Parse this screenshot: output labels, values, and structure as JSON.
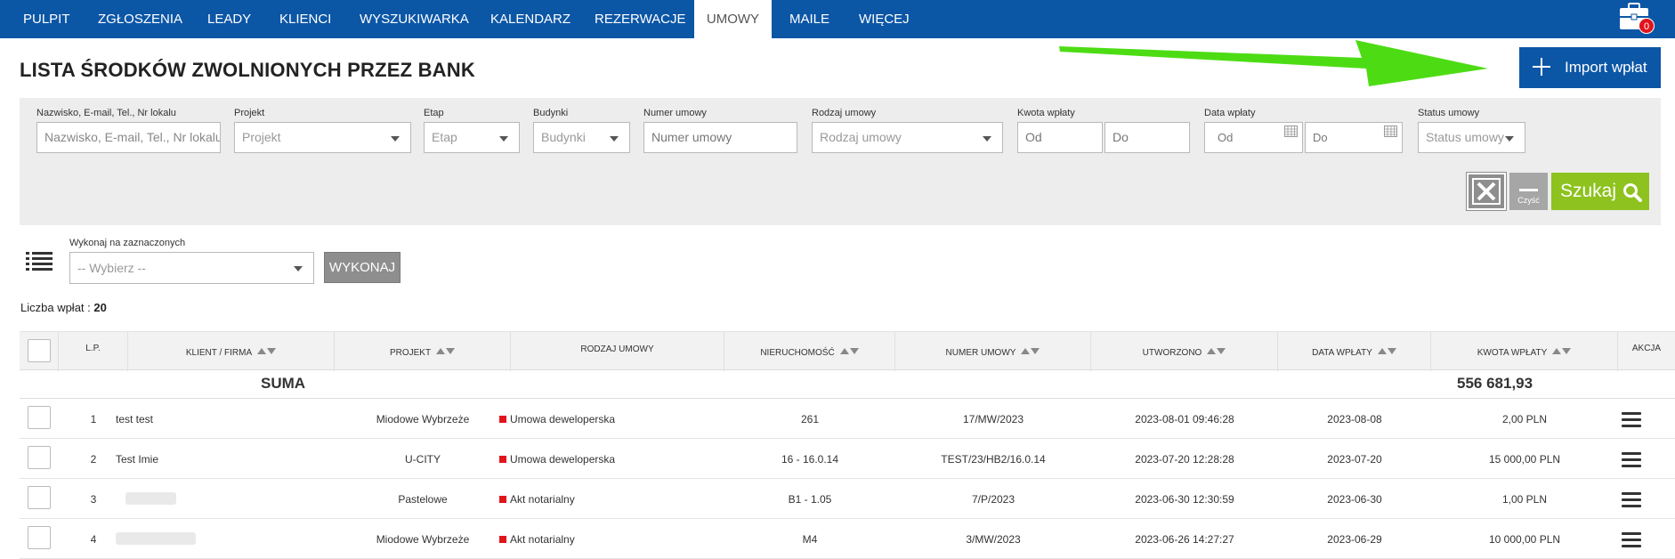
{
  "nav": {
    "items": [
      "PULPIT",
      "ZGŁOSZENIA",
      "LEADY",
      "KLIENCI",
      "WYSZUKIWARKA",
      "KALENDARZ",
      "REZERWACJE",
      "UMOWY",
      "MAILE",
      "WIĘCEJ"
    ],
    "active": "UMOWY",
    "badge_count": "0"
  },
  "page": {
    "title": "LISTA ŚRODKÓW ZWOLNIONYCH PRZEZ BANK",
    "import_button": "Import wpłat"
  },
  "filters": {
    "search": {
      "label": "Nazwisko, E-mail, Tel., Nr lokalu",
      "placeholder": "Nazwisko, E-mail, Tel., Nr lokalu"
    },
    "project": {
      "label": "Projekt",
      "placeholder": "Projekt"
    },
    "stage": {
      "label": "Etap",
      "placeholder": "Etap"
    },
    "buildings": {
      "label": "Budynki",
      "placeholder": "Budynki"
    },
    "contract_number": {
      "label": "Numer umowy",
      "placeholder": "Numer umowy"
    },
    "contract_type": {
      "label": "Rodzaj umowy",
      "placeholder": "Rodzaj umowy"
    },
    "amount": {
      "label": "Kwota wpłaty",
      "from": "Od",
      "to": "Do"
    },
    "date": {
      "label": "Data wpłaty",
      "from": "Od",
      "to": "Do"
    },
    "status": {
      "label": "Status umowy",
      "placeholder": "Status umowy"
    },
    "clear_label": "Czyść",
    "search_button": "Szukaj"
  },
  "bulk": {
    "label": "Wykonaj na zaznaczonych",
    "select_placeholder": "-- Wybierz --",
    "execute_button": "WYKONAJ"
  },
  "count": {
    "label": "Liczba wpłat :",
    "value": "20"
  },
  "table": {
    "headers": {
      "lp": "L.P.",
      "client": "KLIENT / FIRMA",
      "project": "PROJEKT",
      "type": "RODZAJ UMOWY",
      "property": "NIERUCHOMOŚĆ",
      "number": "NUMER UMOWY",
      "created": "UTWORZONO",
      "paid_date": "DATA WPŁATY",
      "amount": "KWOTA WPŁATY",
      "action": "AKCJA"
    },
    "sum_label": "SUMA",
    "sum_value": "556 681,93",
    "rows": [
      {
        "lp": "1",
        "client": "test test",
        "project": "Miodowe Wybrzeże",
        "type": "Umowa deweloperska",
        "property": "261",
        "number": "17/MW/2023",
        "created": "2023-08-01 09:46:28",
        "paid_date": "2023-08-08",
        "amount": "2,00 PLN"
      },
      {
        "lp": "2",
        "client": "Test Imie",
        "project": "U-CITY",
        "type": "Umowa deweloperska",
        "property": "16 - 16.0.14",
        "number": "TEST/23/HB2/16.0.14",
        "created": "2023-07-20 12:28:28",
        "paid_date": "2023-07-20",
        "amount": "15 000,00 PLN"
      },
      {
        "lp": "3",
        "client": "",
        "project": "Pastelowe",
        "type": "Akt notarialny",
        "property": "B1 - 1.05",
        "number": "7/P/2023",
        "created": "2023-06-30 12:30:59",
        "paid_date": "2023-06-30",
        "amount": "1,00 PLN"
      },
      {
        "lp": "4",
        "client": "",
        "project": "Miodowe Wybrzeże",
        "type": "Akt notarialny",
        "property": "M4",
        "number": "3/MW/2023",
        "created": "2023-06-26 14:27:27",
        "paid_date": "2023-06-29",
        "amount": "10 000,00 PLN"
      }
    ]
  },
  "colors": {
    "brand_blue": "#0c56a6",
    "search_green": "#8dc21f",
    "arrow_green": "#4ddc14",
    "status_red": "#e1131c"
  }
}
